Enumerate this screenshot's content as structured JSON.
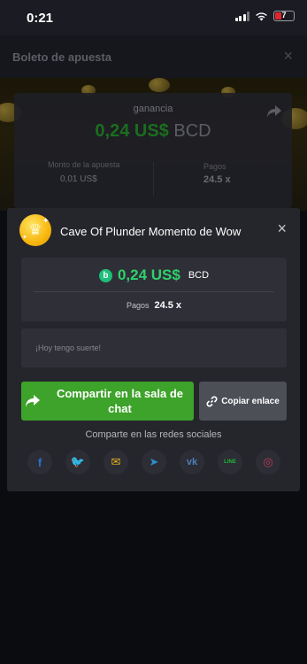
{
  "status_bar": {
    "time": "0:21",
    "battery_level": "7"
  },
  "background": {
    "header_title": "Boleto de apuesta",
    "close_icon": "×",
    "gain_label": "ganancia",
    "gain_amount": "0,24 US$",
    "gain_currency": "BCD",
    "bet_label": "Monto de la apuesta",
    "bet_amount": "0,01 US$",
    "payouts_label": "Pagos",
    "payouts_value": "24.5 x"
  },
  "modal": {
    "title": "Cave Of Plunder Momento de Wow",
    "close_icon": "×",
    "win_amount": "0,24 US$",
    "win_currency": "BCD",
    "coin_glyph": "b",
    "payouts_label": "Pagos",
    "payouts_value": "24.5 x",
    "message_placeholder": "¡Hoy tengo suerte!",
    "share_chat_label": "Compartir en la sala de chat",
    "copy_link_label": "Copiar enlace",
    "social_label": "Comparte en las redes sociales",
    "social_networks": [
      {
        "name": "facebook-icon",
        "glyph": "f",
        "color": "#2d6fd8"
      },
      {
        "name": "twitter-icon",
        "glyph": "🐦",
        "color": "#2a9de8"
      },
      {
        "name": "email-icon",
        "glyph": "✉",
        "color": "#e8b21c"
      },
      {
        "name": "telegram-icon",
        "glyph": "➤",
        "color": "#2b8ec9"
      },
      {
        "name": "vk-icon",
        "glyph": "vk",
        "color": "#4f7fb8"
      },
      {
        "name": "line-icon",
        "glyph": "LINE",
        "color": "#1eb83a"
      },
      {
        "name": "instagram-icon",
        "glyph": "◎",
        "color": "#c13a5a"
      }
    ]
  },
  "colors": {
    "accent_green": "#2ed06d",
    "share_button": "#3da32a",
    "modal_bg": "#25262c"
  }
}
